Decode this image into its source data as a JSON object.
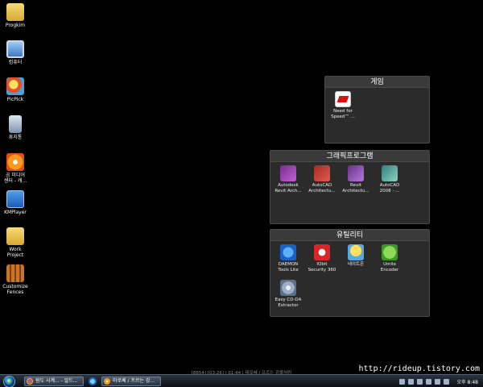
{
  "desktop_icons": [
    {
      "label": "Progkim"
    },
    {
      "label": "컴퓨터"
    },
    {
      "label": "PicPick"
    },
    {
      "label": "휴지통"
    },
    {
      "label": "곰 미디어\n센터 - 캐..."
    },
    {
      "label": "KMPlayer"
    },
    {
      "label": "Work Project"
    },
    {
      "label": "Customize\nFences"
    }
  ],
  "fences": {
    "games": {
      "title": "게임",
      "items": [
        {
          "label": "Need for\nSpeed™ ..."
        }
      ]
    },
    "graphics": {
      "title": "그래픽프로그램",
      "items": [
        {
          "label": "Autodesk\nRevit Arch..."
        },
        {
          "label": "AutoCAD\nArchitectu..."
        },
        {
          "label": "Revit\nArchitectu..."
        },
        {
          "label": "AutoCAD\n2008 - ..."
        }
      ]
    },
    "utilities": {
      "title": "유틸리티",
      "items": [
        {
          "label": "DAEMON\nTools Lite"
        },
        {
          "label": "IObit\nSecurity 360"
        },
        {
          "label": "네이트온"
        },
        {
          "label": "Umile\nEncoder"
        },
        {
          "label": "Easy CD-DA\nExtractor"
        }
      ]
    }
  },
  "status_text": "[8854] [03:26] | 01:44 | 테모쎄 / 프르는 강물처럼",
  "watermark": "http://rideup.tistory.com",
  "taskbar": {
    "buttons": [
      {
        "label": "원도 시계... - 알드..."
      },
      {
        "label": "마로쎄 / 프르는 강..."
      }
    ],
    "clock": "오후 8:48"
  }
}
